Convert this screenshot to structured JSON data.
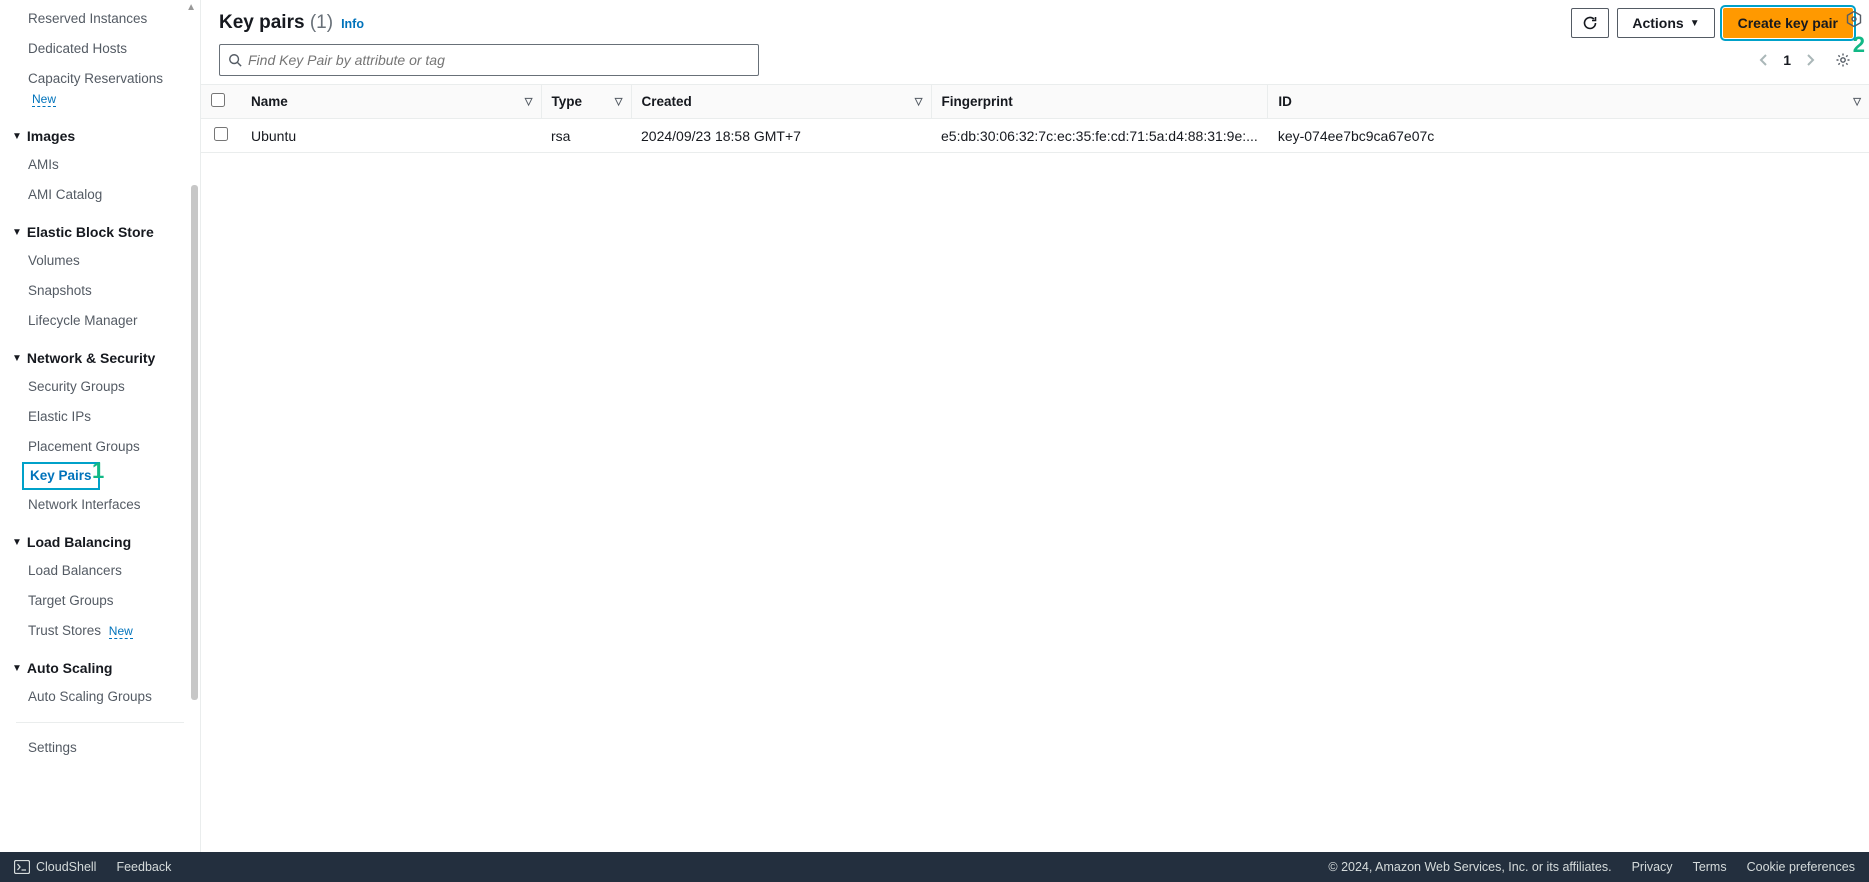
{
  "sidebar": {
    "top_items": [
      "Reserved Instances",
      "Dedicated Hosts"
    ],
    "capacity_item": {
      "label": "Capacity Reservations",
      "badge": "New"
    },
    "sections": [
      {
        "title": "Images",
        "items": [
          "AMIs",
          "AMI Catalog"
        ]
      },
      {
        "title": "Elastic Block Store",
        "items": [
          "Volumes",
          "Snapshots",
          "Lifecycle Manager"
        ]
      },
      {
        "title": "Network & Security",
        "items": [
          "Security Groups",
          "Elastic IPs",
          "Placement Groups",
          "Key Pairs",
          "Network Interfaces"
        ],
        "active": "Key Pairs"
      },
      {
        "title": "Load Balancing",
        "items": [
          "Load Balancers",
          "Target Groups",
          "Trust Stores"
        ],
        "badges": {
          "Trust Stores": "New"
        }
      },
      {
        "title": "Auto Scaling",
        "items": [
          "Auto Scaling Groups"
        ]
      }
    ],
    "bottom_items": [
      "Settings"
    ]
  },
  "header": {
    "title": "Key pairs",
    "count": "(1)",
    "info": "Info",
    "refresh_tooltip": "Refresh",
    "actions_label": "Actions",
    "create_label": "Create key pair"
  },
  "search": {
    "placeholder": "Find Key Pair by attribute or tag"
  },
  "pagination": {
    "current": "1"
  },
  "table": {
    "columns": [
      "Name",
      "Type",
      "Created",
      "Fingerprint",
      "ID"
    ],
    "rows": [
      {
        "name": "Ubuntu",
        "type": "rsa",
        "created": "2024/09/23 18:58 GMT+7",
        "fingerprint": "e5:db:30:06:32:7c:ec:35:fe:cd:71:5a:d4:88:31:9e:...",
        "id": "key-074ee7bc9ca67e07c"
      }
    ]
  },
  "annotations": {
    "sidebar_num": "1",
    "create_num": "2"
  },
  "footer": {
    "cloudshell": "CloudShell",
    "feedback": "Feedback",
    "copyright": "© 2024, Amazon Web Services, Inc. or its affiliates.",
    "links": [
      "Privacy",
      "Terms",
      "Cookie preferences"
    ]
  }
}
